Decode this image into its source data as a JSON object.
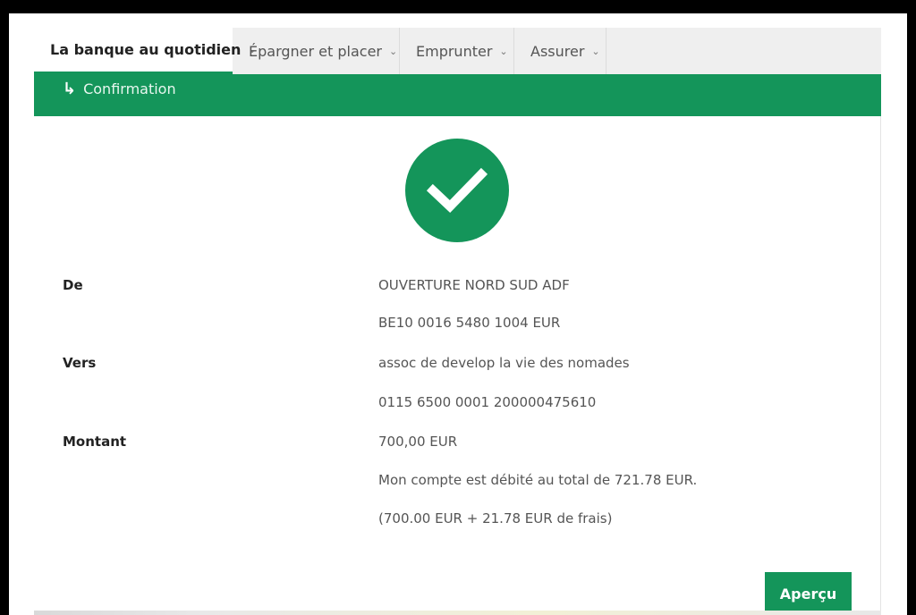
{
  "nav": {
    "tabs": [
      {
        "label": "La banque au quotidien",
        "active": true
      },
      {
        "label": "Épargner et placer",
        "active": false
      },
      {
        "label": "Emprunter",
        "active": false
      },
      {
        "label": "Assurer",
        "active": false
      }
    ]
  },
  "breadcrumb": {
    "label": "Confirmation",
    "icon": "arrow-turn-right-icon"
  },
  "status": {
    "icon": "checkmark-icon",
    "color": "#14955a"
  },
  "details": {
    "from_label": "De",
    "from_name": "OUVERTURE NORD SUD ADF",
    "from_account": "BE10 0016 5480 1004 EUR",
    "to_label": "Vers",
    "to_name": "assoc de develop la vie des nomades",
    "to_account": "0115 6500 0001 200000475610",
    "amount_label": "Montant",
    "amount": "700,00 EUR",
    "total_note": "Mon compte est débité au total de 721.78 EUR.",
    "fee_note": "(700.00 EUR + 21.78 EUR de frais)"
  },
  "actions": {
    "preview_label": "Aperçu"
  },
  "theme": {
    "accent": "#14955a"
  }
}
